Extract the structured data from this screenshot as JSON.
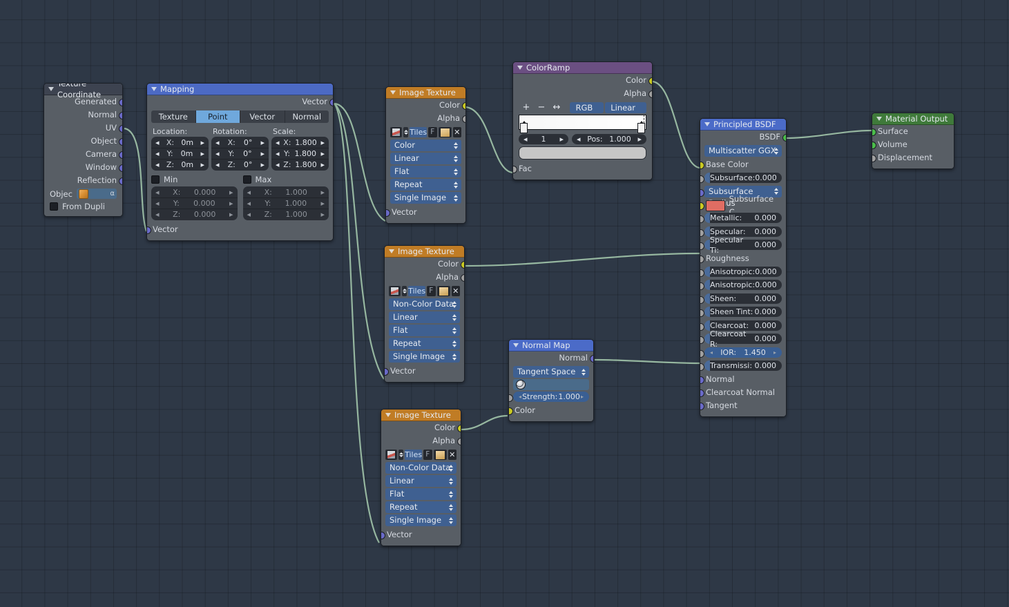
{
  "editor": {
    "name": "blender-shader-node-editor",
    "background": "#2e3846",
    "grid_color": "#242c38"
  },
  "nodes": {
    "texture_coordinate": {
      "title": "Texture Coordinate",
      "header_color": "#3d4350",
      "outputs": [
        "Generated",
        "Normal",
        "UV",
        "Object",
        "Camera",
        "Window",
        "Reflection"
      ],
      "object_label": "Objec",
      "from_dupli_label": "From Dupli"
    },
    "mapping": {
      "title": "Mapping",
      "header_color": "#4c6ac4",
      "output": "Vector",
      "tabs": [
        "Texture",
        "Point",
        "Vector",
        "Normal"
      ],
      "active_tab": "Point",
      "groups": [
        {
          "label": "Location:",
          "rows": [
            {
              "k": "X:",
              "v": "0m"
            },
            {
              "k": "Y:",
              "v": "0m"
            },
            {
              "k": "Z:",
              "v": "0m"
            }
          ]
        },
        {
          "label": "Rotation:",
          "rows": [
            {
              "k": "X:",
              "v": "0°"
            },
            {
              "k": "Y:",
              "v": "0°"
            },
            {
              "k": "Z:",
              "v": "0°"
            }
          ]
        },
        {
          "label": "Scale:",
          "rows": [
            {
              "k": "X:",
              "v": "1.800"
            },
            {
              "k": "Y:",
              "v": "1.800"
            },
            {
              "k": "Z:",
              "v": "1.800"
            }
          ]
        }
      ],
      "min_label": "Min",
      "max_label": "Max",
      "min_rows": [
        {
          "k": "X:",
          "v": "0.000"
        },
        {
          "k": "Y:",
          "v": "0.000"
        },
        {
          "k": "Z:",
          "v": "0.000"
        }
      ],
      "max_rows": [
        {
          "k": "X:",
          "v": "1.000"
        },
        {
          "k": "Y:",
          "v": "1.000"
        },
        {
          "k": "Z:",
          "v": "1.000"
        }
      ],
      "input": "Vector"
    },
    "image_texture_1": {
      "title": "Image Texture",
      "header_color": "#c07c25",
      "outputs": [
        "Color",
        "Alpha"
      ],
      "datablock_name": "Tiles",
      "fake_user": "F",
      "close": "✕",
      "dropdowns": [
        "Color",
        "Linear",
        "Flat",
        "Repeat",
        "Single Image"
      ],
      "input": "Vector"
    },
    "image_texture_2": {
      "title": "Image Texture",
      "header_color": "#c07c25",
      "outputs": [
        "Color",
        "Alpha"
      ],
      "datablock_name": "Tiles",
      "fake_user": "F",
      "close": "✕",
      "dropdowns": [
        "Non-Color Data",
        "Linear",
        "Flat",
        "Repeat",
        "Single Image"
      ],
      "input": "Vector"
    },
    "image_texture_3": {
      "title": "Image Texture",
      "header_color": "#c07c25",
      "outputs": [
        "Color",
        "Alpha"
      ],
      "datablock_name": "Tiles",
      "fake_user": "F",
      "close": "✕",
      "dropdowns": [
        "Non-Color Data",
        "Linear",
        "Flat",
        "Repeat",
        "Single Image"
      ],
      "input": "Vector"
    },
    "color_ramp": {
      "title": "ColorRamp",
      "header_color": "#6b4f82",
      "outputs": [
        "Color",
        "Alpha"
      ],
      "tools": [
        "+",
        "−",
        "↔"
      ],
      "color_mode": "RGB",
      "interpolation": "Linear",
      "index": "1",
      "pos_label": "Pos:",
      "pos_value": "1.000",
      "input": "Fac",
      "ramp_start_color": "#f5f5f5",
      "ramp_end_color": "#ffffff",
      "selected_color": "#c6c6c6"
    },
    "normal_map": {
      "title": "Normal Map",
      "header_color": "#4b6bc8",
      "output": "Normal",
      "space": "Tangent Space",
      "uv_map": "",
      "strength_label": "Strength:",
      "strength_value": "1.000",
      "input": "Color"
    },
    "principled_bsdf": {
      "title": "Principled BSDF",
      "header_color": "#4b6bc8",
      "output": "BSDF",
      "distribution": "Multiscatter GGX",
      "rows": [
        {
          "type": "socket-label",
          "label": "Base Color",
          "sock": "col"
        },
        {
          "type": "slider",
          "label": "Subsurface:",
          "value": "0.000",
          "sock": "gray"
        },
        {
          "type": "dropdown",
          "label": "Subsurface Radius",
          "sock": "vec"
        },
        {
          "type": "swatch",
          "label": "Subsurface C...",
          "color": "#e06d63",
          "sock": "col"
        },
        {
          "type": "slider",
          "label": "Metallic:",
          "value": "0.000",
          "sock": "gray"
        },
        {
          "type": "slider",
          "label": "Specular:",
          "value": "0.000",
          "sock": "gray"
        },
        {
          "type": "slider",
          "label": "Specular Ti:",
          "value": "0.000",
          "sock": "gray"
        },
        {
          "type": "socket-label",
          "label": "Roughness",
          "sock": "gray"
        },
        {
          "type": "slider",
          "label": "Anisotropic:",
          "value": "0.000",
          "sock": "gray"
        },
        {
          "type": "slider",
          "label": "Anisotropic:",
          "value": "0.000",
          "sock": "gray"
        },
        {
          "type": "slider",
          "label": "Sheen:",
          "value": "0.000",
          "sock": "gray"
        },
        {
          "type": "slider",
          "label": "Sheen Tint:",
          "value": "0.000",
          "sock": "gray"
        },
        {
          "type": "slider",
          "label": "Clearcoat:",
          "value": "0.000",
          "sock": "gray"
        },
        {
          "type": "slider",
          "label": "Clearcoat R:",
          "value": "0.000",
          "sock": "gray"
        },
        {
          "type": "number-hi",
          "label": "IOR:",
          "value": "1.450",
          "sock": "gray"
        },
        {
          "type": "slider",
          "label": "Transmissi:",
          "value": "0.000",
          "sock": "gray"
        },
        {
          "type": "socket-label",
          "label": "Normal",
          "sock": "vec"
        },
        {
          "type": "socket-label",
          "label": "Clearcoat Normal",
          "sock": "vec"
        },
        {
          "type": "socket-label",
          "label": "Tangent",
          "sock": "vec"
        }
      ]
    },
    "material_output": {
      "title": "Material Output",
      "header_color": "#3f7a3a",
      "inputs": [
        "Surface",
        "Volume",
        "Displacement"
      ]
    }
  },
  "links": [
    {
      "from": "texture-coordinate.UV",
      "to": "mapping.Vector"
    },
    {
      "from": "mapping.Vector",
      "to": "image-texture-1.Vector"
    },
    {
      "from": "mapping.Vector",
      "to": "image-texture-2.Vector"
    },
    {
      "from": "mapping.Vector",
      "to": "image-texture-3.Vector"
    },
    {
      "from": "image-texture-1.Color",
      "to": "color-ramp.Fac"
    },
    {
      "from": "color-ramp.Color",
      "to": "principled-bsdf.Base Color"
    },
    {
      "from": "image-texture-2.Color",
      "to": "principled-bsdf.Roughness"
    },
    {
      "from": "image-texture-3.Color",
      "to": "normal-map.Color"
    },
    {
      "from": "normal-map.Normal",
      "to": "principled-bsdf.Normal"
    },
    {
      "from": "principled-bsdf.BSDF",
      "to": "material-output.Surface"
    }
  ]
}
